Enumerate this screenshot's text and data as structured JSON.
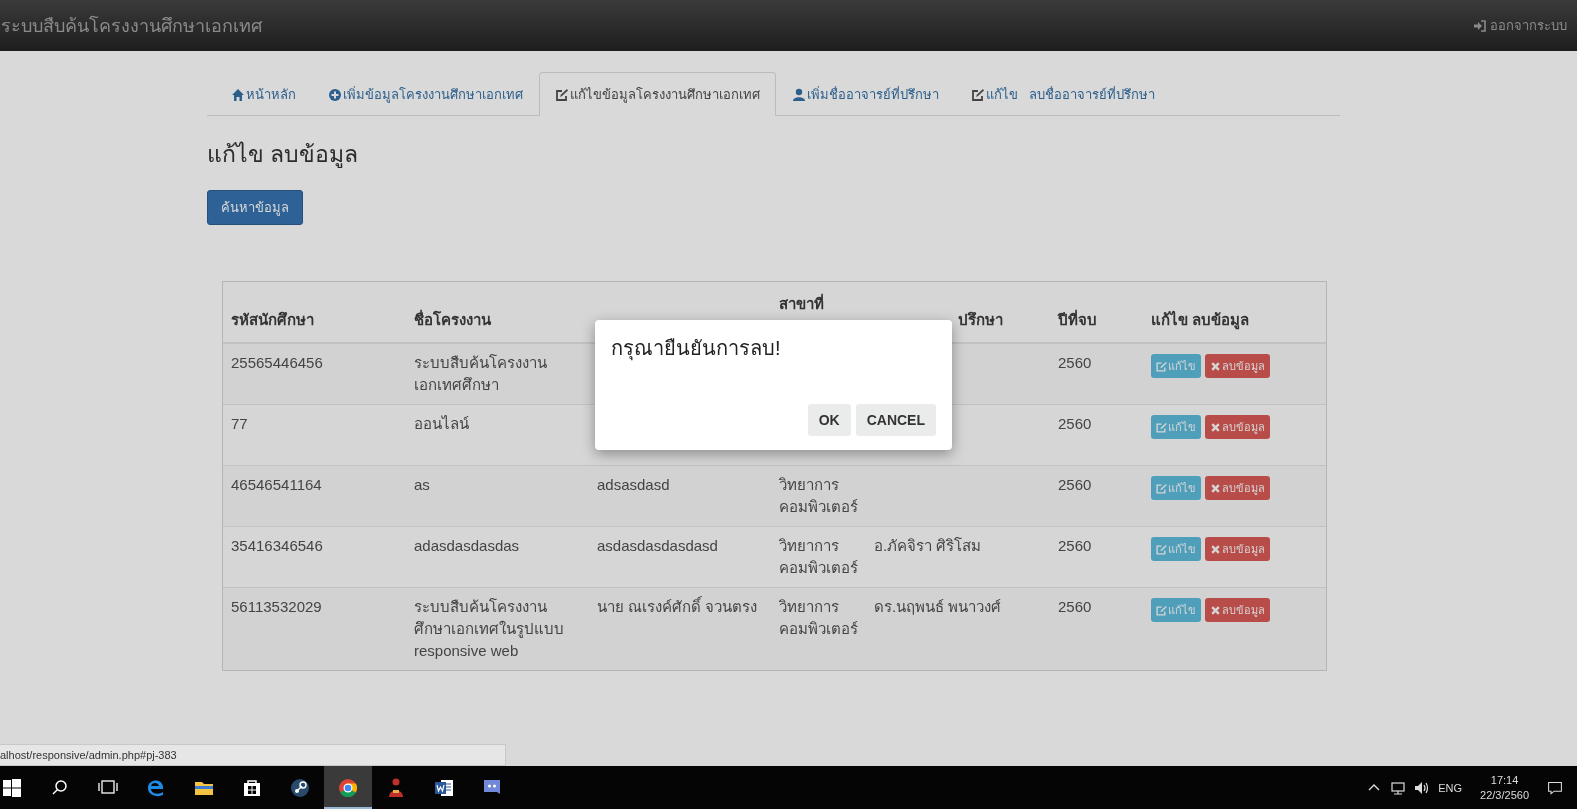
{
  "navbar": {
    "title": "ระบบสืบค้นโครงงานศึกษาเอกเทศ",
    "logout": "ออกจากระบบ"
  },
  "tabs": [
    {
      "kind": "home",
      "label": "หน้าหลัก",
      "selected": false
    },
    {
      "kind": "plus",
      "label": "เพิ่มข้อมูลโครงงานศึกษาเอกเทศ",
      "selected": false
    },
    {
      "kind": "edit",
      "label": "แก้ไขข้อมูลโครงงานศึกษาเอกเทศ",
      "selected": true
    },
    {
      "kind": "user",
      "label": "เพิ่มชื่ออาจารย์ที่ปรึกษา",
      "selected": false
    },
    {
      "kind": "edit",
      "label": "แก้ไข   ลบชื่ออาจารย์ที่ปรึกษา",
      "selected": false
    }
  ],
  "heading": "แก้ไข ลบข้อมูล",
  "search_button": "ค้นหาข้อมูล",
  "table": {
    "columns": [
      {
        "label": "รหัสนักศึกษา"
      },
      {
        "label": "ชื่อโครงงาน"
      },
      {},
      {
        "label": "สาขาที่"
      },
      {
        "label": "ปรึกษา"
      },
      {
        "label": "ปีที่จบ"
      },
      {
        "label": "แก้ไข ลบข้อมูล"
      }
    ],
    "rows": [
      {
        "cells": [
          "25565446456",
          "ระบบสืบค้นโครงงาน\nเอกเทศศึกษา",
          "",
          "",
          "",
          "2560"
        ],
        "actions": [
          {
            "kind": "edit",
            "label": "แก้ไข"
          },
          {
            "kind": "delete",
            "label": "ลบข้อมูล"
          }
        ]
      },
      {
        "cells": [
          "77",
          "ออนไลน์",
          "",
          "",
          "",
          "2560"
        ],
        "actions": [
          {
            "kind": "edit",
            "label": "แก้ไข"
          },
          {
            "kind": "delete",
            "label": "ลบข้อมูล"
          }
        ]
      },
      {
        "cells": [
          "46546541164",
          "as",
          "adsasdasd",
          "วิทยาการ\nคอมพิวเตอร์",
          "",
          "2560"
        ],
        "actions": [
          {
            "kind": "edit",
            "label": "แก้ไข"
          },
          {
            "kind": "delete",
            "label": "ลบข้อมูล"
          }
        ]
      },
      {
        "cells": [
          "35416346546",
          "adasdasdasdas",
          "asdasdasdasdasd",
          "วิทยาการ\nคอมพิวเตอร์",
          "อ.ภัคจิรา ศิริโสม",
          "2560"
        ],
        "actions": [
          {
            "kind": "edit",
            "label": "แก้ไข"
          },
          {
            "kind": "delete",
            "label": "ลบข้อมูล"
          }
        ]
      },
      {
        "cells": [
          "56113532029",
          "ระบบสืบค้นโครงงาน\nศึกษาเอกเทศในรูปแบบ\nresponsive web",
          "นาย ณเรงค์ศักดิ์ จวนตรง",
          "วิทยาการ\nคอมพิวเตอร์",
          "ดร.นฤพนธ์ พนาวงศ์",
          "2560"
        ],
        "actions": [
          {
            "kind": "edit",
            "label": "แก้ไข"
          },
          {
            "kind": "delete",
            "label": "ลบข้อมูล"
          }
        ]
      }
    ]
  },
  "dialog": {
    "message": "กรุณายืนยันการลบ!",
    "buttons": [
      "OK",
      "CANCEL"
    ]
  },
  "status_url": "alhost/responsive/admin.php#pj-383",
  "taskbar": {
    "apps": [
      {
        "kind": "search",
        "selected": false
      },
      {
        "kind": "taskview",
        "selected": false
      },
      {
        "kind": "edge",
        "selected": false
      },
      {
        "kind": "folder",
        "selected": false
      },
      {
        "kind": "store",
        "selected": false
      },
      {
        "kind": "steam",
        "selected": false
      },
      {
        "kind": "chrome",
        "selected": true
      },
      {
        "kind": "figure",
        "selected": false
      },
      {
        "kind": "word",
        "selected": false
      },
      {
        "kind": "discord",
        "selected": false
      }
    ],
    "language": "ENG",
    "time": "17:14",
    "date": "22/3/2560"
  }
}
